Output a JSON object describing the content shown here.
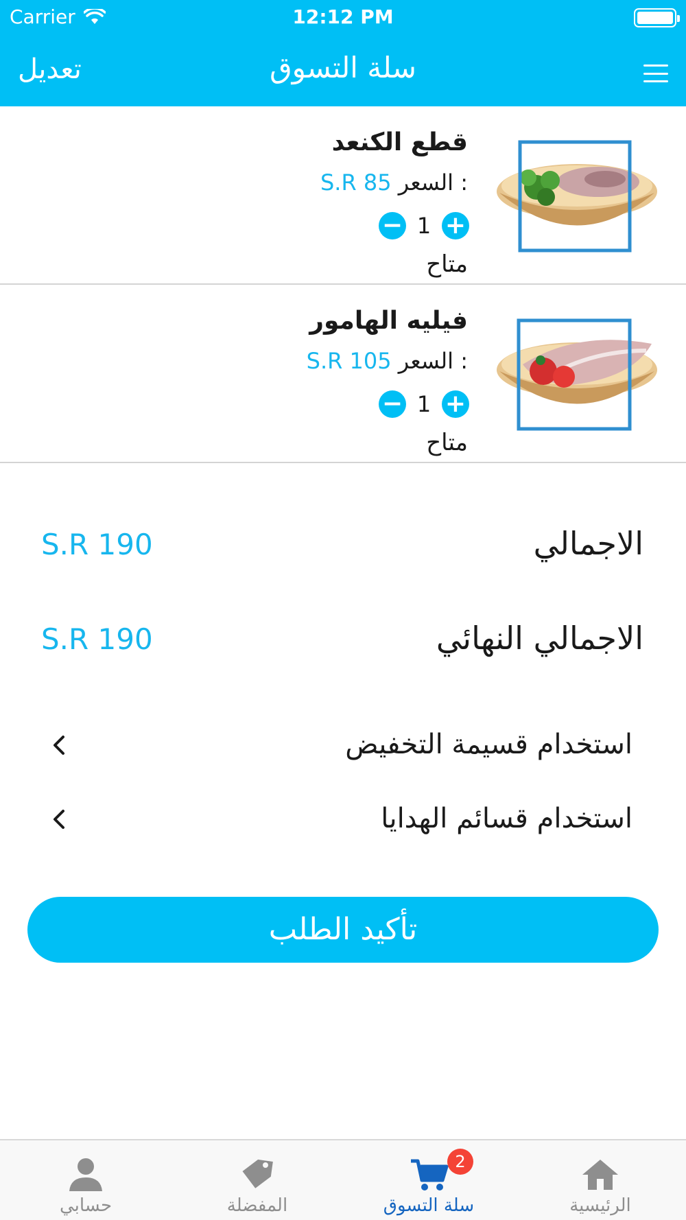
{
  "status_bar": {
    "carrier": "Carrier",
    "time": "12:12 PM"
  },
  "nav": {
    "edit_label": "تعديل",
    "title": "سلة التسوق"
  },
  "cart_items": [
    {
      "name": "قطع الكنعد",
      "price_label": "السعر :",
      "price_value": "S.R 85",
      "quantity": "1",
      "availability": "متاح"
    },
    {
      "name": "فيليه الهامور",
      "price_label": "السعر :",
      "price_value": "S.R 105",
      "quantity": "1",
      "availability": "متاح"
    }
  ],
  "totals": {
    "subtotal_label": "الاجمالي",
    "subtotal_value": "S.R 190",
    "final_label": "الاجمالي النهائي",
    "final_value": "S.R 190"
  },
  "options": {
    "discount_coupon": "استخدام قسيمة التخفيض",
    "gift_vouchers": "استخدام قسائم الهدايا"
  },
  "confirm_button": "تأكيد الطلب",
  "tabbar": {
    "account": "حسابي",
    "favorites": "المفضلة",
    "cart": "سلة التسوق",
    "home": "الرئيسية",
    "cart_badge": "2"
  },
  "colors": {
    "brand": "#00bff5",
    "price": "#17b6ee",
    "active_tab": "#1565c0",
    "badge": "#f44336"
  },
  "icons": {
    "cart_item_1": "fish-steaks-on-wooden-board",
    "cart_item_2": "fish-fillet-on-wooden-board",
    "tab_account": "person-icon",
    "tab_favorites": "tag-icon",
    "tab_cart": "cart-icon",
    "tab_home": "home-icon"
  }
}
